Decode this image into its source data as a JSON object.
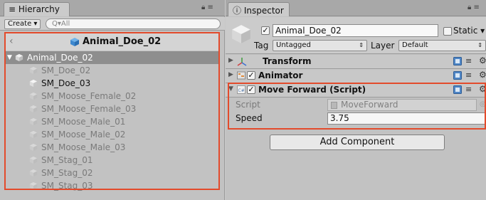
{
  "hierarchy": {
    "tab_label": "Hierarchy",
    "tab_icons": "≡",
    "create_label": "Create ▾",
    "search_placeholder": "Q▾All",
    "breadcrumb": "Animal_Doe_02",
    "root": "Animal_Doe_02",
    "children": [
      {
        "label": "SM_Doe_02",
        "active": false
      },
      {
        "label": "SM_Doe_03",
        "active": true
      },
      {
        "label": "SM_Moose_Female_02",
        "active": false
      },
      {
        "label": "SM_Moose_Female_03",
        "active": false
      },
      {
        "label": "SM_Moose_Male_01",
        "active": false
      },
      {
        "label": "SM_Moose_Male_02",
        "active": false
      },
      {
        "label": "SM_Moose_Male_03",
        "active": false
      },
      {
        "label": "SM_Stag_01",
        "active": false
      },
      {
        "label": "SM_Stag_02",
        "active": false
      },
      {
        "label": "SM_Stag_03",
        "active": false
      }
    ]
  },
  "inspector": {
    "tab_label": "Inspector",
    "tab_icons": "≡",
    "object_name": "Animal_Doe_02",
    "static_label": "Static ▾",
    "tag_label": "Tag",
    "tag_value": "Untagged",
    "layer_label": "Layer",
    "layer_value": "Default",
    "components": [
      {
        "name": "Transform"
      },
      {
        "name": "Animator"
      },
      {
        "name": "Move Forward (Script)"
      }
    ],
    "script_label": "Script",
    "script_value": "MoveForward",
    "speed_label": "Speed",
    "speed_value": "3.75",
    "add_component": "Add Component"
  },
  "colors": {
    "highlight": "#e34b2c",
    "selection": "#8e8e8e",
    "panel": "#c2c2c2"
  }
}
